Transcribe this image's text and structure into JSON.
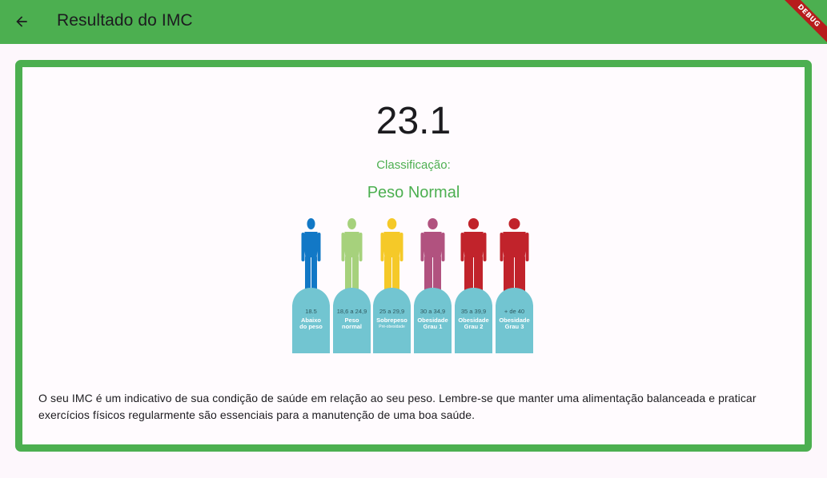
{
  "appbar": {
    "title": "Resultado do IMC",
    "back_icon": "arrow-left-icon",
    "debug_label": "DEBUG"
  },
  "result": {
    "value": "23.1",
    "classification_label": "Classificação:",
    "classification": "Peso Normal"
  },
  "bmi_chart": {
    "categories": [
      {
        "range": "18.5",
        "label_line1": "Abaixo",
        "label_line2": "do peso",
        "sub": "",
        "color": "#1278c6"
      },
      {
        "range": "18,6 a 24,9",
        "label_line1": "Peso",
        "label_line2": "normal",
        "sub": "",
        "color": "#a6d17c"
      },
      {
        "range": "25 a 29,9",
        "label_line1": "Sobrepeso",
        "label_line2": "",
        "sub": "Pré-obesidade",
        "color": "#f5c928"
      },
      {
        "range": "30 a 34,9",
        "label_line1": "Obesidade",
        "label_line2": "Grau 1",
        "sub": "",
        "color": "#b1527f"
      },
      {
        "range": "35 a 39,9",
        "label_line1": "Obesidade",
        "label_line2": "Grau 2",
        "sub": "",
        "color": "#c1232b"
      },
      {
        "range": "+ de 40",
        "label_line1": "Obesidade",
        "label_line2": "Grau 3",
        "sub": "",
        "color": "#c1232b"
      }
    ],
    "tomb_color": "#72c5d1"
  },
  "description": "O seu IMC é um indicativo de sua condição de saúde em relação ao seu peso. Lembre-se que manter uma alimentação balanceada e praticar exercícios físicos regularmente são essenciais para a manutenção de uma boa saúde.",
  "colors": {
    "primary": "#4caf50",
    "background": "#fdf7fc",
    "text": "#1c1b1f"
  }
}
